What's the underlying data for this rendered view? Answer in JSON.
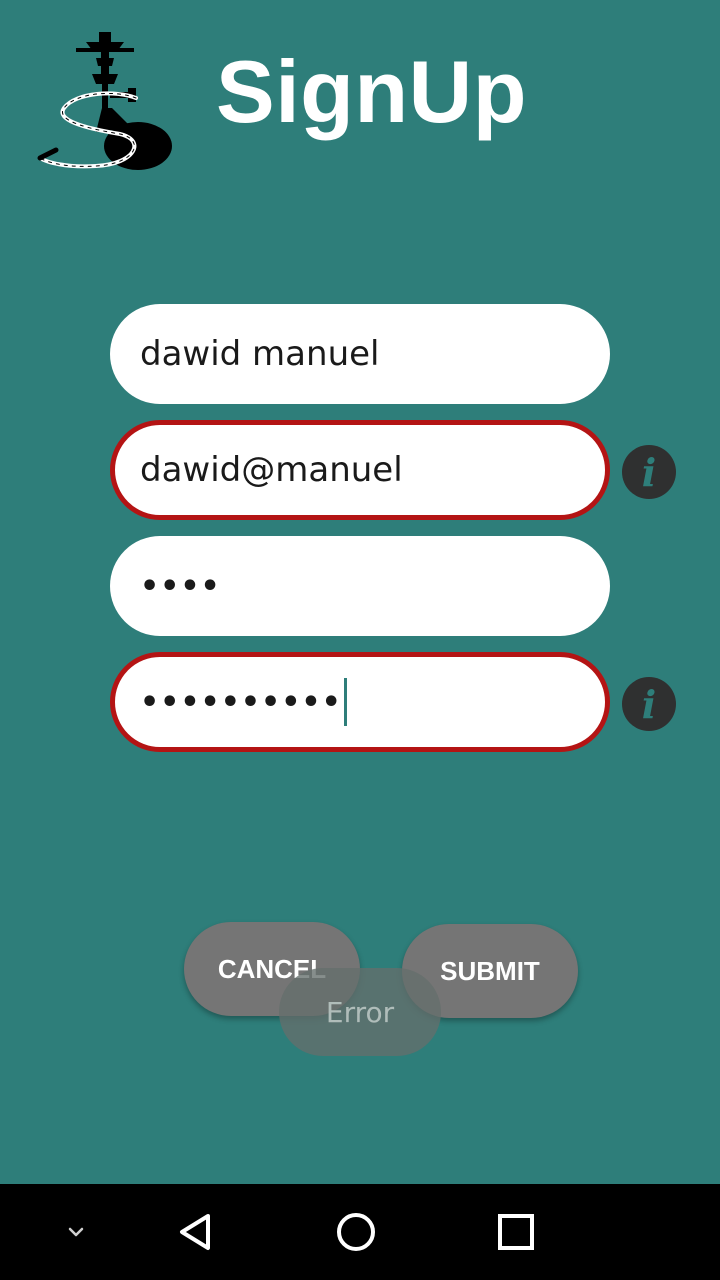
{
  "header": {
    "title": "SignUp",
    "logo_icon": "hookah-logo-icon"
  },
  "form": {
    "fields": [
      {
        "name": "name",
        "value": "dawid manuel",
        "error": false
      },
      {
        "name": "email",
        "value": "dawid@manuel",
        "error": true
      },
      {
        "name": "password",
        "value": "••••",
        "error": false
      },
      {
        "name": "confirm-password",
        "value": "••••••••••",
        "error": true
      }
    ],
    "info_icon": "i"
  },
  "buttons": {
    "cancel_label": "CANCEL",
    "submit_label": "SUBMIT"
  },
  "toast": {
    "message": "Error"
  },
  "navbar": {
    "items": [
      "chevron-down-icon",
      "back-icon",
      "home-icon",
      "recents-icon"
    ]
  },
  "colors": {
    "background": "#2E7E7A",
    "error_border": "#B41414",
    "button": "#757575"
  }
}
